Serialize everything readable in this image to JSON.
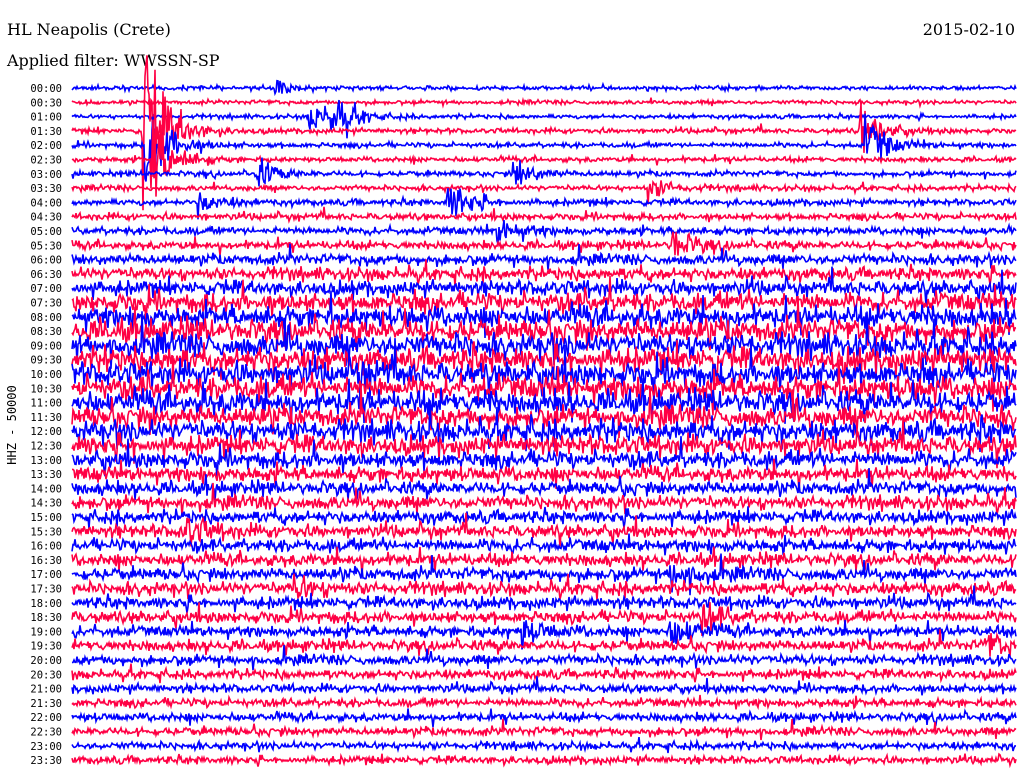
{
  "header": {
    "station": "HL Neapolis (Crete)",
    "date": "2015-02-10",
    "filter": "Applied filter: WWSSN-SP"
  },
  "chart_data": {
    "type": "line",
    "title": "HL Neapolis (Crete)",
    "subtitle": "Applied filter: WWSSN-SP",
    "ylabel": "HHZ - 50000",
    "xlabel": "",
    "minutes_per_line": 30,
    "colors": [
      "#0000ff",
      "#ff0044"
    ],
    "row_labels": [
      "00:00",
      "00:30",
      "01:00",
      "01:30",
      "02:00",
      "02:30",
      "03:00",
      "03:30",
      "04:00",
      "04:30",
      "05:00",
      "05:30",
      "06:00",
      "06:30",
      "07:00",
      "07:30",
      "08:00",
      "08:30",
      "09:00",
      "09:30",
      "10:00",
      "10:30",
      "11:00",
      "11:30",
      "12:00",
      "12:30",
      "13:00",
      "13:30",
      "14:00",
      "14:30",
      "15:00",
      "15:30",
      "16:00",
      "16:30",
      "17:00",
      "17:30",
      "18:00",
      "18:30",
      "19:00",
      "19:30",
      "20:00",
      "20:30",
      "21:00",
      "21:30",
      "22:00",
      "22:30",
      "23:00",
      "23:30"
    ],
    "noise_level": [
      1,
      1,
      1,
      1.2,
      1.2,
      1.2,
      1.3,
      1.3,
      1.5,
      1.6,
      1.8,
      2,
      2.5,
      3,
      3.5,
      4.5,
      5,
      5.5,
      5.5,
      5.5,
      5.5,
      5.5,
      5.5,
      5,
      5,
      4.5,
      4,
      3.5,
      3.2,
      3.2,
      3,
      3,
      3,
      3,
      3,
      3,
      2.8,
      2.8,
      2.6,
      2.6,
      2.4,
      2.2,
      2,
      2,
      2,
      2,
      1.8,
      1.8
    ],
    "events": [
      {
        "row": 3,
        "minute": 2.2,
        "amplitude": 60
      },
      {
        "row": 4,
        "minute": 2.3,
        "amplitude": 30
      },
      {
        "row": 5,
        "minute": 2.5,
        "amplitude": 25
      },
      {
        "row": 2,
        "minute": 7.5,
        "amplitude": 10
      },
      {
        "row": 2,
        "minute": 8.2,
        "amplitude": 12
      },
      {
        "row": 0,
        "minute": 6.4,
        "amplitude": 4
      },
      {
        "row": 3,
        "minute": 25.0,
        "amplitude": 14
      },
      {
        "row": 4,
        "minute": 25.2,
        "amplitude": 14
      },
      {
        "row": 6,
        "minute": 5.8,
        "amplitude": 8
      },
      {
        "row": 6,
        "minute": 14.0,
        "amplitude": 8
      },
      {
        "row": 7,
        "minute": 18.3,
        "amplitude": 7
      },
      {
        "row": 8,
        "minute": 4.0,
        "amplitude": 6
      },
      {
        "row": 8,
        "minute": 11.9,
        "amplitude": 12
      },
      {
        "row": 10,
        "minute": 13.5,
        "amplitude": 8
      },
      {
        "row": 11,
        "minute": 19.0,
        "amplitude": 9
      },
      {
        "row": 20,
        "minute": 9.0,
        "amplitude": 8
      },
      {
        "row": 31,
        "minute": 3.5,
        "amplitude": 8
      },
      {
        "row": 34,
        "minute": 19.0,
        "amplitude": 10
      },
      {
        "row": 35,
        "minute": 7.0,
        "amplitude": 7
      },
      {
        "row": 37,
        "minute": 20.0,
        "amplitude": 8
      },
      {
        "row": 38,
        "minute": 19.0,
        "amplitude": 9
      },
      {
        "row": 38,
        "minute": 14.3,
        "amplitude": 7
      },
      {
        "row": 39,
        "minute": 29.0,
        "amplitude": 7
      }
    ]
  }
}
